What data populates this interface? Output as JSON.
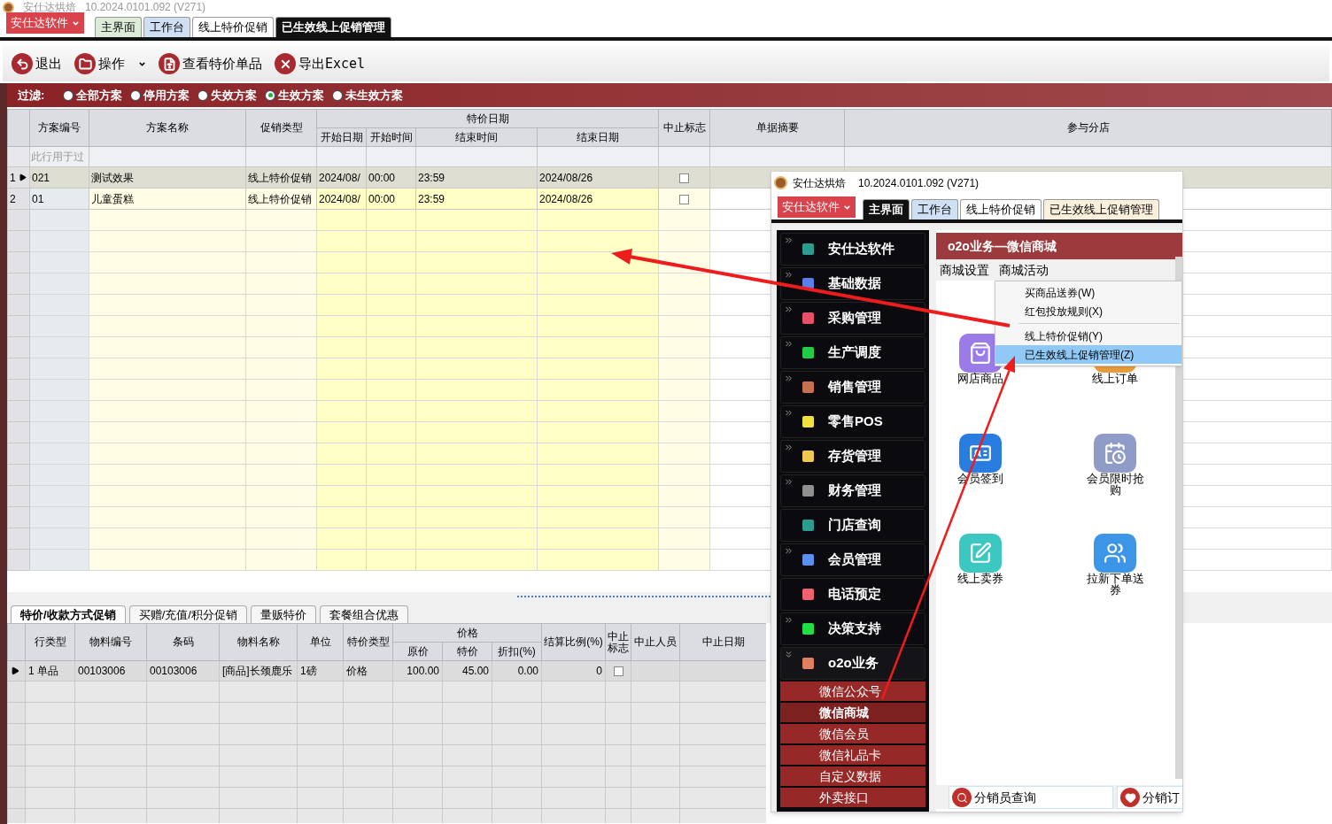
{
  "app_title": {
    "name": "安仕达烘焙",
    "version": "10.2024.0101.092 (V271)"
  },
  "app_menu": "安仕达软件",
  "tabs": [
    {
      "label": "主界面",
      "selected": false,
      "color": "#dcecd8"
    },
    {
      "label": "工作台",
      "selected": false,
      "color": "#cfe0f5"
    },
    {
      "label": "线上特价促销",
      "selected": false,
      "color": "#ffffff"
    },
    {
      "label": "已生效线上促销管理",
      "selected": true
    }
  ],
  "toolbar": [
    {
      "label": "退出",
      "kind": "exit",
      "dropdown": false
    },
    {
      "label": "操作",
      "kind": "folder",
      "dropdown": true
    },
    {
      "label": "查看特价单品",
      "kind": "document",
      "dropdown": false
    },
    {
      "label": "导出Excel",
      "kind": "excel",
      "dropdown": false
    }
  ],
  "filter": {
    "label": "过滤:",
    "options": [
      {
        "label": "全部方案",
        "selected": false
      },
      {
        "label": "停用方案",
        "selected": false
      },
      {
        "label": "失效方案",
        "selected": false
      },
      {
        "label": "生效方案",
        "selected": true
      },
      {
        "label": "未生效方案",
        "selected": false
      }
    ]
  },
  "plans_table": {
    "columns": [
      {
        "label": "方案编号"
      },
      {
        "label": "方案名称"
      },
      {
        "label": "促销类型"
      },
      {
        "label": "特价日期",
        "children": [
          {
            "label": "开始日期"
          },
          {
            "label": "开始时间"
          },
          {
            "label": "结束时间"
          },
          {
            "label": "结束日期"
          }
        ]
      },
      {
        "label": "中止标志"
      },
      {
        "label": "单据摘要"
      },
      {
        "label": "参与分店"
      }
    ],
    "filter_row_hint": "此行用于过",
    "rows": [
      {
        "number": "1",
        "current": true,
        "values": [
          "021",
          "测试效果",
          "线上特价促销",
          "2024/08/",
          "00:00",
          "23:59",
          "2024/08/26"
        ],
        "stopped": false
      },
      {
        "number": "2",
        "current": false,
        "values": [
          "01",
          "儿童蛋糕",
          "线上特价促销",
          "2024/08/",
          "00:00",
          "23:59",
          "2024/08/26"
        ],
        "stopped": false
      }
    ]
  },
  "detail_tabs": [
    {
      "label": "特价/收款方式促销",
      "selected": true
    },
    {
      "label": "买赠/充值/积分促销",
      "selected": false
    },
    {
      "label": "量贩特价",
      "selected": false
    },
    {
      "label": "套餐组合优惠",
      "selected": false
    }
  ],
  "detail_table": {
    "columns": [
      {
        "label": "行类型"
      },
      {
        "label": "物料编号"
      },
      {
        "label": "条码"
      },
      {
        "label": "物料名称"
      },
      {
        "label": "单位"
      },
      {
        "label": "特价类型"
      },
      {
        "label": "价格",
        "children": [
          {
            "label": "原价"
          },
          {
            "label": "特价"
          },
          {
            "label": "折扣(%)"
          }
        ]
      },
      {
        "label": "结算比例(%)"
      },
      {
        "label": "中止标志"
      },
      {
        "label": "中止人员"
      },
      {
        "label": "中止日期"
      }
    ],
    "rows": [
      {
        "current": true,
        "values": [
          "1 单品",
          "00103006",
          "00103006",
          "[商品]长颈鹿乐",
          "1磅",
          "价格",
          "100.00",
          "45.00",
          "0.00",
          "0"
        ],
        "stopped": false
      }
    ]
  },
  "inset_window": {
    "title": {
      "name": "安仕达烘焙",
      "version": "10.2024.0101.092 (V271)"
    },
    "app_menu": "安仕达软件",
    "tabs": [
      {
        "label": "主界面",
        "selected": true
      },
      {
        "label": "工作台",
        "selected": false,
        "color": "#cfe0f5"
      },
      {
        "label": "线上特价促销",
        "selected": false,
        "color": "#ffffff"
      },
      {
        "label": "已生效线上促销管理",
        "selected": false,
        "color": "#fbf0dc"
      }
    ],
    "nav": [
      {
        "label": "安仕达软件",
        "expandable": true,
        "expanded": false,
        "color": "#2a9d8f"
      },
      {
        "label": "基础数据",
        "expandable": true,
        "expanded": false,
        "color": "#5b7fe8"
      },
      {
        "label": "采购管理",
        "expandable": true,
        "expanded": false,
        "color": "#e8506a"
      },
      {
        "label": "生产调度",
        "expandable": true,
        "expanded": false,
        "color": "#22cc44"
      },
      {
        "label": "销售管理",
        "expandable": true,
        "expanded": false,
        "color": "#c87050"
      },
      {
        "label": "零售POS",
        "expandable": true,
        "expanded": false,
        "color": "#f0e040"
      },
      {
        "label": "存货管理",
        "expandable": true,
        "expanded": false,
        "color": "#f0c850"
      },
      {
        "label": "财务管理",
        "expandable": true,
        "expanded": false,
        "color": "#909090"
      },
      {
        "label": "门店查询",
        "expandable": false,
        "color": "#2a9d8f"
      },
      {
        "label": "会员管理",
        "expandable": true,
        "expanded": false,
        "color": "#5b8ff0"
      },
      {
        "label": "电话预定",
        "expandable": false,
        "color": "#f06070"
      },
      {
        "label": "决策支持",
        "expandable": true,
        "expanded": false,
        "color": "#22dd44"
      },
      {
        "label": "o2o业务",
        "expandable": true,
        "expanded": true,
        "color": "#e08060",
        "children": [
          {
            "label": "微信公众号",
            "selected": false
          },
          {
            "label": "微信商城",
            "selected": true
          },
          {
            "label": "微信会员",
            "selected": false
          },
          {
            "label": "微信礼品卡",
            "selected": false
          },
          {
            "label": "自定义数据",
            "selected": false
          },
          {
            "label": "外卖接口",
            "selected": false
          }
        ]
      }
    ],
    "panel_title": "o2o业务—微信商城",
    "menu_bar": [
      "商城设置",
      "商城活动"
    ],
    "dropdown_groups": [
      [
        {
          "label": "买商品送券(W)",
          "selected": false
        },
        {
          "label": "红包投放规则(X)",
          "selected": false
        }
      ],
      [
        {
          "label": "线上特价促销(Y)",
          "selected": false
        },
        {
          "label": "已生效线上促销管理(Z)",
          "selected": true
        }
      ]
    ],
    "tiles": [
      {
        "label": "网店商品",
        "kind": "shop",
        "color": "#9b7be8"
      },
      {
        "label": "线上订单",
        "kind": "order",
        "color": "#e89b3b"
      },
      {
        "label": "会员签到",
        "kind": "checkin",
        "color": "#2a7de0"
      },
      {
        "label": "会员限时抢购",
        "kind": "flash",
        "color": "#8f9cc8"
      },
      {
        "label": "线上卖券",
        "kind": "coupon",
        "color": "#3cc8c0"
      },
      {
        "label": "拉新下单送券",
        "kind": "referral",
        "color": "#3d95e8"
      }
    ],
    "bottom_links": [
      {
        "label": "分销员查询",
        "kind": "search"
      },
      {
        "label": "分销订",
        "kind": "heart"
      }
    ]
  }
}
